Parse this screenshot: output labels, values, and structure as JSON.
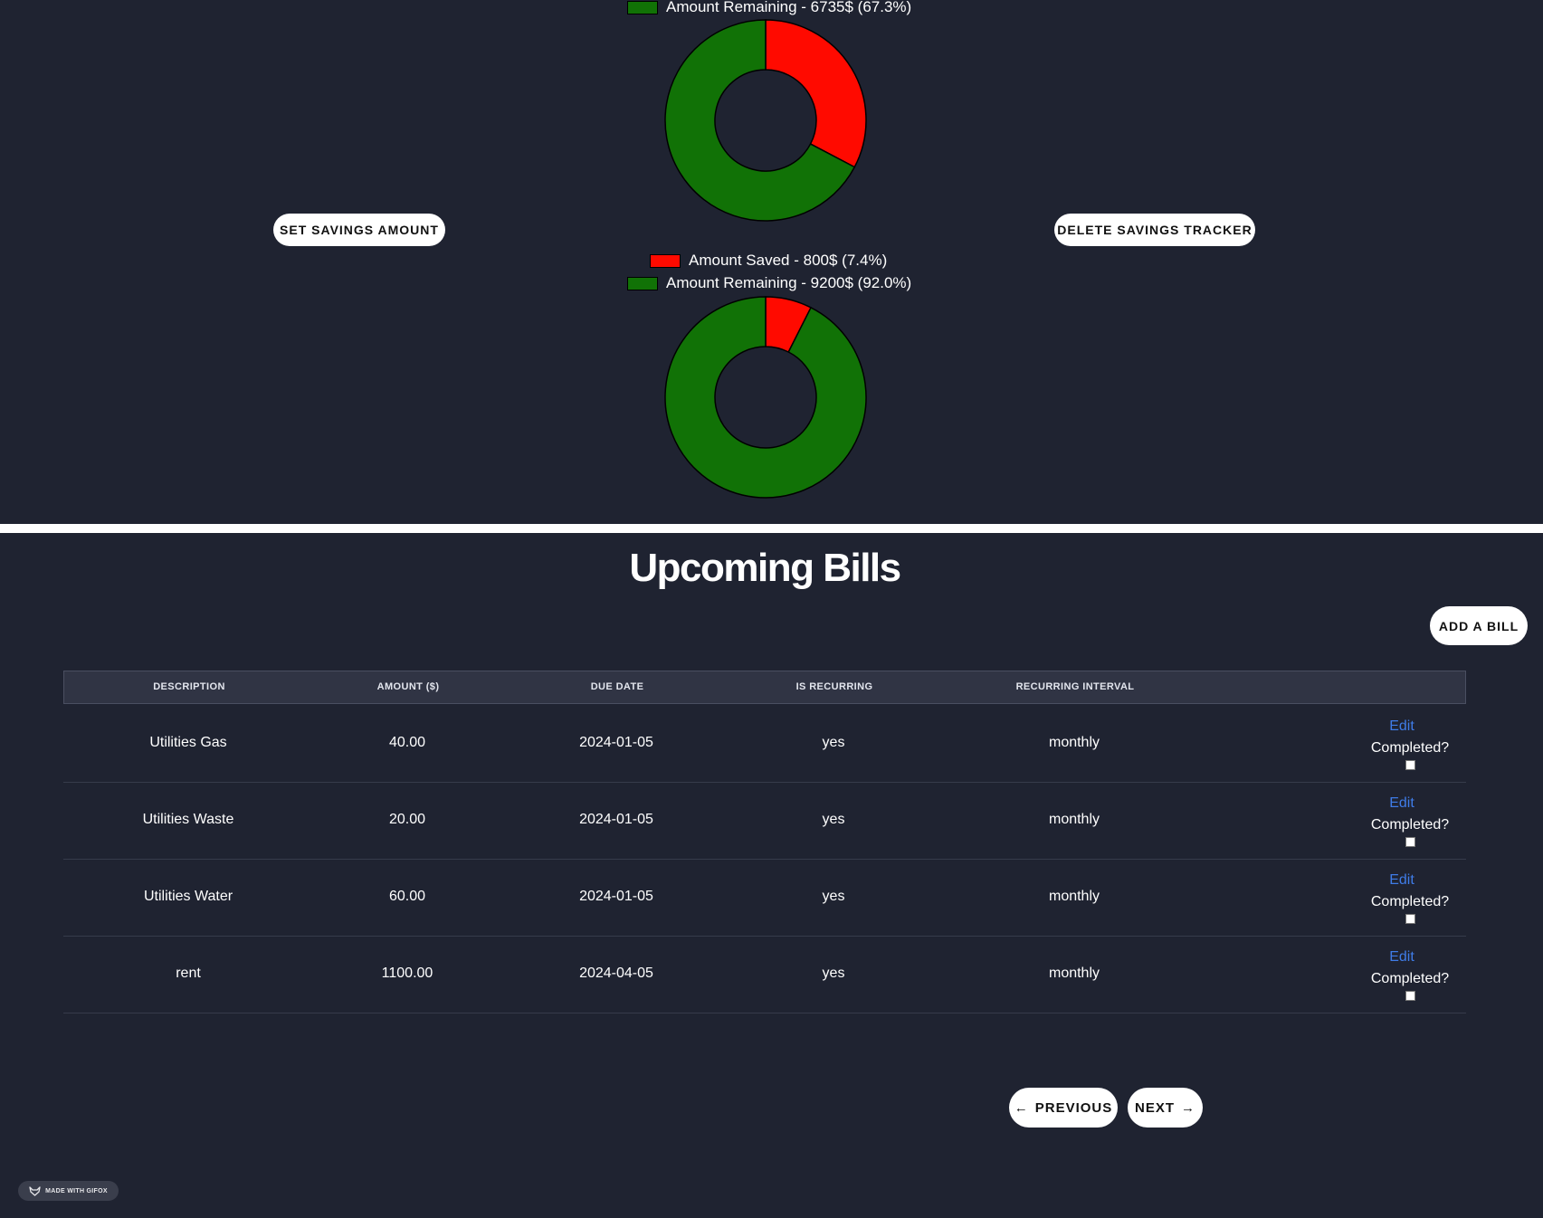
{
  "savings_trackers": [
    {
      "legend": [
        {
          "label": "Amount Remaining - 6735$ (67.3%)",
          "color": "#117206"
        }
      ],
      "chart_data": {
        "type": "pie",
        "categories": [
          "Amount Saved",
          "Amount Remaining"
        ],
        "values": [
          32.7,
          67.3
        ],
        "colors": [
          "#ff0a00",
          "#117206"
        ]
      }
    },
    {
      "legend": [
        {
          "label": "Amount Saved - 800$ (7.4%)",
          "color": "#ff0a00"
        },
        {
          "label": "Amount Remaining - 9200$ (92.0%)",
          "color": "#117206"
        }
      ],
      "chart_data": {
        "type": "pie",
        "categories": [
          "Amount Saved",
          "Amount Remaining"
        ],
        "values": [
          7.4,
          92.0
        ],
        "colors": [
          "#ff0a00",
          "#117206"
        ]
      }
    }
  ],
  "savings_controls": {
    "set_label": "SET SAVINGS AMOUNT",
    "delete_label": "DELETE SAVINGS TRACKER"
  },
  "bills": {
    "title": "Upcoming Bills",
    "add_label": "ADD A BILL",
    "columns": [
      "DESCRIPTION",
      "AMOUNT ($)",
      "DUE DATE",
      "IS RECURRING",
      "RECURRING INTERVAL"
    ],
    "rows": [
      {
        "description": "Utilities Gas",
        "amount": "40.00",
        "due_date": "2024-01-05",
        "recurring": "yes",
        "interval": "monthly",
        "edit": "Edit",
        "completed": "Completed?"
      },
      {
        "description": "Utilities Waste",
        "amount": "20.00",
        "due_date": "2024-01-05",
        "recurring": "yes",
        "interval": "monthly",
        "edit": "Edit",
        "completed": "Completed?"
      },
      {
        "description": "Utilities Water",
        "amount": "60.00",
        "due_date": "2024-01-05",
        "recurring": "yes",
        "interval": "monthly",
        "edit": "Edit",
        "completed": "Completed?"
      },
      {
        "description": "rent",
        "amount": "1100.00",
        "due_date": "2024-04-05",
        "recurring": "yes",
        "interval": "monthly",
        "edit": "Edit",
        "completed": "Completed?"
      }
    ]
  },
  "pagination": {
    "previous_label": "PREVIOUS",
    "next_label": "NEXT"
  },
  "badge": {
    "label": "MADE WITH GIFOX",
    "icon": "gifox-fox-icon"
  },
  "colors": {
    "background": "#1f2331",
    "saved": "#ff0a00",
    "remaining": "#117206",
    "link": "#3f7ce8",
    "table_header": "#303444"
  }
}
